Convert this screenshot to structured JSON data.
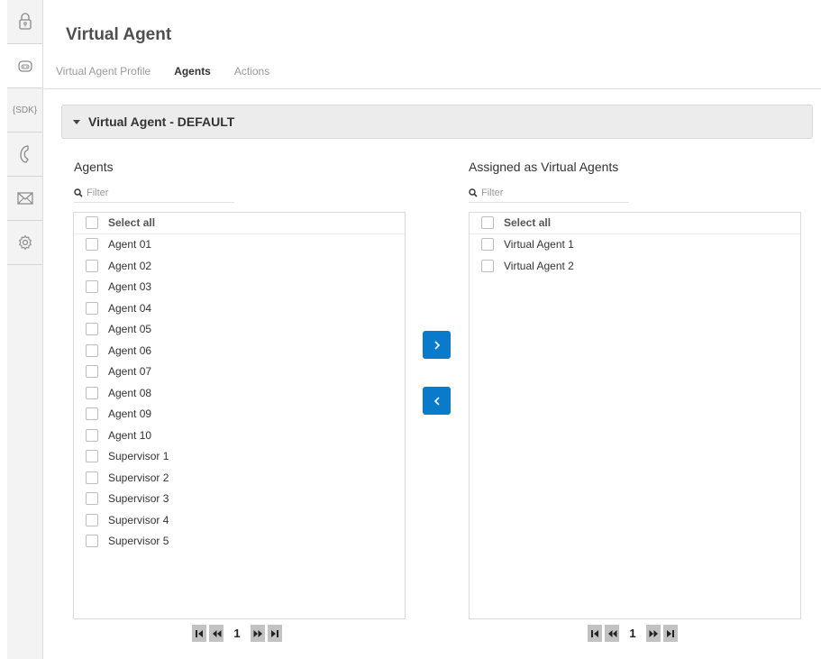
{
  "header": {
    "title": "Virtual Agent"
  },
  "tabs": [
    {
      "label": "Virtual Agent Profile",
      "active": false
    },
    {
      "label": "Agents",
      "active": true
    },
    {
      "label": "Actions",
      "active": false
    }
  ],
  "rail": {
    "items": [
      {
        "icon": "lock-icon"
      },
      {
        "icon": "bot-icon",
        "active": true
      },
      {
        "icon": "sdk-icon",
        "label": "{SDK}"
      },
      {
        "icon": "phone-icon"
      },
      {
        "icon": "mail-icon"
      },
      {
        "icon": "gear-icon"
      }
    ]
  },
  "section": {
    "title": "Virtual Agent - DEFAULT",
    "expanded": true
  },
  "agents_panel": {
    "title": "Agents",
    "filter_placeholder": "Filter",
    "select_all_label": "Select all",
    "items": [
      "Agent 01",
      "Agent 02",
      "Agent 03",
      "Agent 04",
      "Agent 05",
      "Agent 06",
      "Agent 07",
      "Agent 08",
      "Agent 09",
      "Agent 10",
      "Supervisor 1",
      "Supervisor 2",
      "Supervisor 3",
      "Supervisor 4",
      "Supervisor 5"
    ],
    "page": "1"
  },
  "assigned_panel": {
    "title": "Assigned as Virtual Agents",
    "filter_placeholder": "Filter",
    "select_all_label": "Select all",
    "items": [
      "Virtual Agent 1",
      "Virtual Agent 2"
    ],
    "page": "1"
  },
  "colors": {
    "accent": "#0a7acb",
    "pager_button": "#c2c2c2"
  }
}
